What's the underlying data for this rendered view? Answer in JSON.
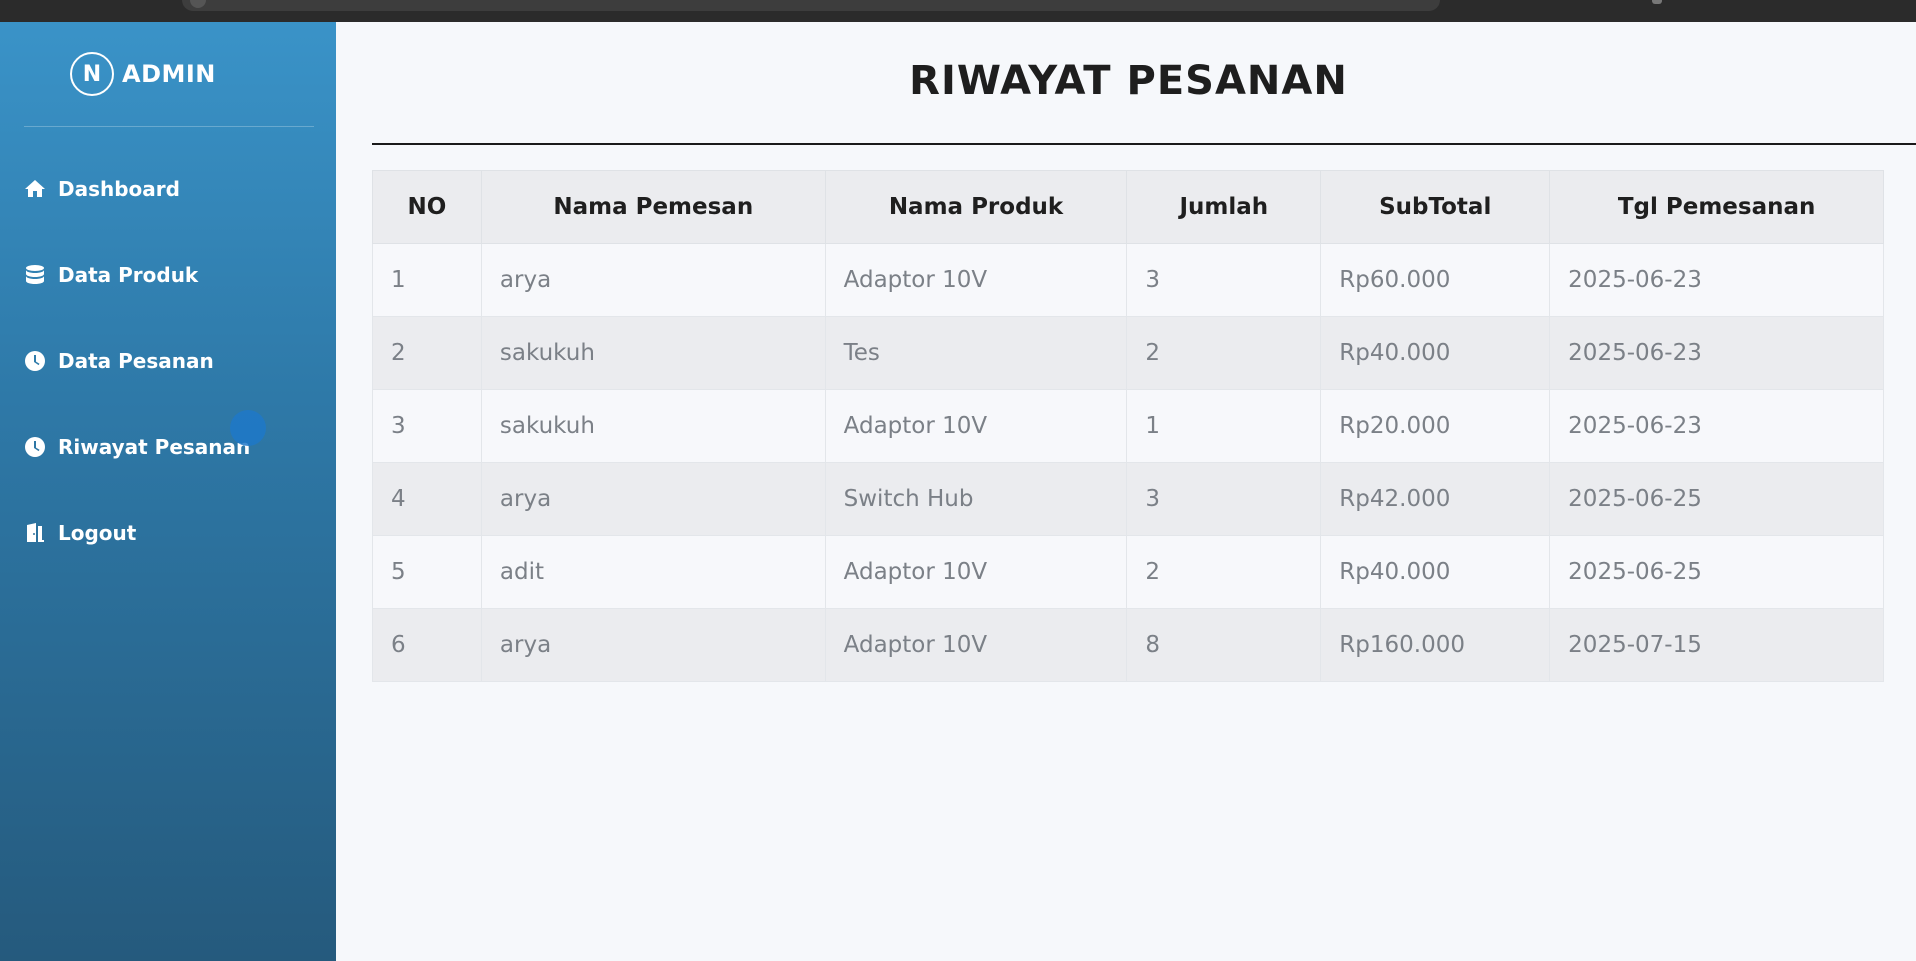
{
  "brand": {
    "logo_letter": "N",
    "name": "ADMIN"
  },
  "nav": {
    "dashboard": "Dashboard",
    "data_produk": "Data Produk",
    "data_pesanan": "Data Pesanan",
    "riwayat_pesanan": "Riwayat Pesanan",
    "logout": "Logout"
  },
  "page": {
    "title": "RIWAYAT PESANAN"
  },
  "table": {
    "headers": [
      "NO",
      "Nama Pemesan",
      "Nama Produk",
      "Jumlah",
      "SubTotal",
      "Tgl Pemesanan"
    ],
    "rows": [
      [
        "1",
        "arya",
        "Adaptor 10V",
        "3",
        "Rp60.000",
        "2025-06-23"
      ],
      [
        "2",
        "sakukuh",
        "Tes",
        "2",
        "Rp40.000",
        "2025-06-23"
      ],
      [
        "3",
        "sakukuh",
        "Adaptor 10V",
        "1",
        "Rp20.000",
        "2025-06-23"
      ],
      [
        "4",
        "arya",
        "Switch Hub",
        "3",
        "Rp42.000",
        "2025-06-25"
      ],
      [
        "5",
        "adit",
        "Adaptor 10V",
        "2",
        "Rp40.000",
        "2025-06-25"
      ],
      [
        "6",
        "arya",
        "Adaptor 10V",
        "8",
        "Rp160.000",
        "2025-07-15"
      ]
    ]
  },
  "icons": {
    "dashboard": "home-icon",
    "data_produk": "database-icon",
    "data_pesanan": "clock-icon",
    "riwayat_pesanan": "clock-icon",
    "logout": "door-exit-icon"
  },
  "colors": {
    "sidebar_top": "#3a93c8",
    "sidebar_bottom": "#255a7d",
    "background": "#f6f8fb"
  }
}
